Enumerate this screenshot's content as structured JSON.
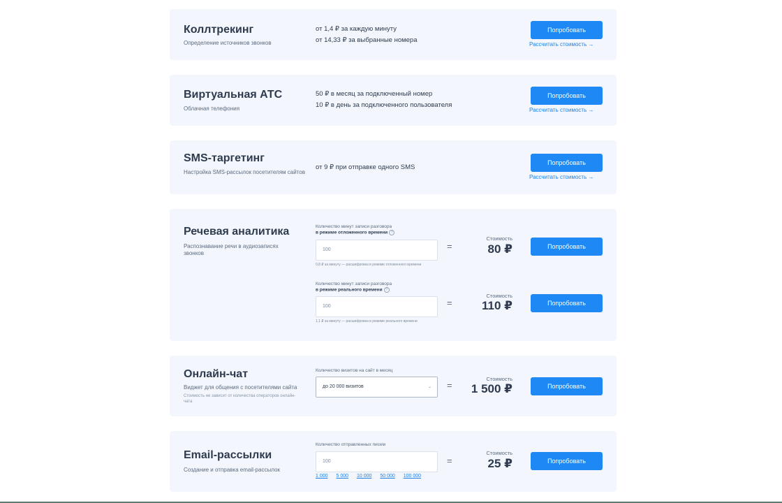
{
  "common": {
    "try_label": "Попробовать",
    "calc_label": "Рассчитать стоимость",
    "cost_label": "Стоимость",
    "equals": "=",
    "arrow": "→"
  },
  "products": {
    "calltracking": {
      "title": "Коллтрекинг",
      "subtitle": "Определение источников звонков",
      "price_lines": [
        "от 1,4 ₽ за каждую минуту",
        "от 14,33 ₽ за выбранные номера"
      ]
    },
    "vats": {
      "title": "Виртуальная АТС",
      "subtitle": "Облачная телефония",
      "price_lines": [
        "50 ₽ в месяц за подключенный номер",
        "10 ₽ в день за подключенного пользователя"
      ]
    },
    "sms": {
      "title": "SMS-таргетинг",
      "subtitle": "Настройка SMS-рассылок посетителям сайтов",
      "price_lines": [
        "от 9 ₽ при отправке одного SMS"
      ]
    },
    "speech": {
      "title": "Речевая аналитика",
      "subtitle": "Распознавание речи в аудиозаписях звонков",
      "deferred": {
        "label_top": "Количество минут записи разговора",
        "label_bold": "в режиме отложенного времени",
        "input_value": "100",
        "hint": "0,8 ₽ за минуту — расшифровка в режиме отложенного времени",
        "cost": "80 ₽"
      },
      "realtime": {
        "label_top": "Количество минут записи разговора",
        "label_bold": "в режиме реального времени",
        "input_value": "100",
        "hint": "1,1 ₽ за минуту — расшифровка в режиме реального времени",
        "cost": "110 ₽"
      }
    },
    "chat": {
      "title": "Онлайн-чат",
      "subtitle": "Виджет для общения с посетителями сайта",
      "note": "Стоимость не зависит от количества операторов онлайн-чата",
      "field_label": "Количество визитов на сайт в месяц",
      "select_value": "до 20 000 визитов",
      "cost": "1 500 ₽"
    },
    "email": {
      "title": "Email-рассылки",
      "subtitle": "Создание и отправка email-рассылок",
      "field_label": "Количество отправленных писем",
      "input_value": "100",
      "quick_values": [
        "1 000",
        "5 000",
        "10 000",
        "50 000",
        "100 000"
      ],
      "cost": "25 ₽"
    }
  }
}
